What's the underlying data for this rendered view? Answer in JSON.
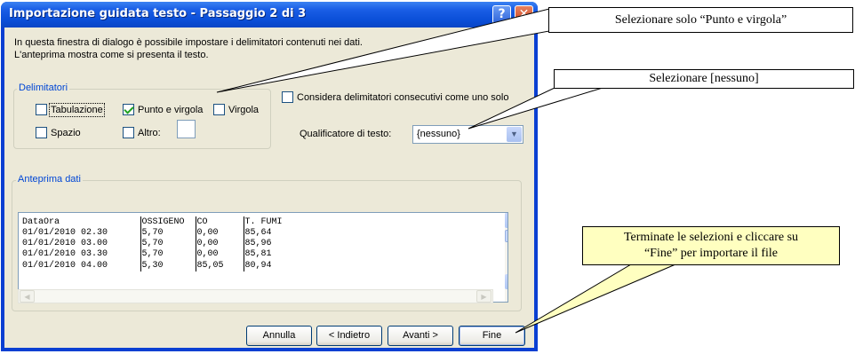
{
  "window": {
    "title": "Importazione guidata testo - Passaggio 2 di 3"
  },
  "title_buttons": {
    "help": "?",
    "close": "✕"
  },
  "intro": [
    "In questa finestra di dialogo è possibile impostare i delimitatori contenuti nei dati.",
    "L'anteprima mostra come si presenta il testo."
  ],
  "delimiters": {
    "legend": "Delimitatori",
    "tabulazione": {
      "label": "Tabulazione",
      "checked": false
    },
    "punto_e_virgola": {
      "label": "Punto e virgola",
      "checked": true
    },
    "virgola": {
      "label": "Virgola",
      "checked": false
    },
    "spazio": {
      "label": "Spazio",
      "checked": false
    },
    "altro": {
      "label": "Altro:",
      "checked": false,
      "value": ""
    }
  },
  "consecutive": {
    "label": "Considera delimitatori consecutivi come uno solo",
    "checked": false
  },
  "qualifier": {
    "label": "Qualificatore di testo:",
    "value": "{nessuno}"
  },
  "preview": {
    "legend": "Anteprima dati",
    "rows": [
      [
        "DataOra",
        "OSSIGENO",
        "CO",
        "T. FUMI"
      ],
      [
        "01/01/2010 02.30",
        "5,70",
        "0,00",
        "85,64"
      ],
      [
        "01/01/2010 03.00",
        "5,70",
        "0,00",
        "85,96"
      ],
      [
        "01/01/2010 03.30",
        "5,70",
        "0,00",
        "85,81"
      ],
      [
        "01/01/2010 04.00",
        "5,30",
        "85,05",
        "80,94"
      ]
    ]
  },
  "buttons": {
    "annulla": "Annulla",
    "indietro": "< Indietro",
    "avanti": "Avanti >",
    "fine": "Fine"
  },
  "callouts": {
    "punto": "Selezionare solo “Punto e virgola”",
    "nessuno": "Selezionare [nessuno]",
    "fine_line1": "Terminate le selezioni e cliccare su",
    "fine_line2": "“Fine” per importare il file"
  }
}
